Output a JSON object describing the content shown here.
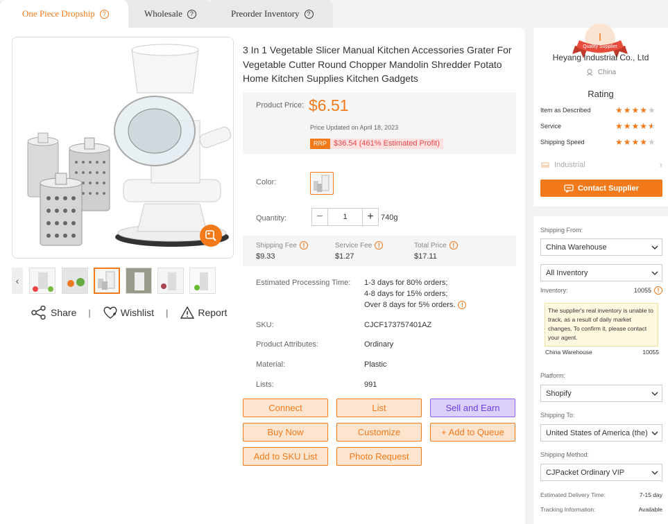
{
  "tabs": [
    {
      "label": "One Piece Dropship",
      "active": true
    },
    {
      "label": "Wholesale",
      "active": false
    },
    {
      "label": "Preorder Inventory",
      "active": false
    }
  ],
  "product": {
    "title": "3 In 1 Vegetable Slicer Manual Kitchen Accessories Grater For Vegetable Cutter Round Chopper Mandolin Shredder Potato Home Kitchen Supplies Kitchen Gadgets",
    "price_label": "Product Price:",
    "price": "$6.51",
    "price_updated": "Price Updated on April 18, 2023",
    "rrp_tag": "RRP",
    "rrp_value": "$36.54 (461% Estimated Profit)",
    "color_label": "Color:",
    "quantity_label": "Quantity:",
    "quantity": "1",
    "weight": "740g",
    "fees": [
      {
        "label": "Shipping Fee",
        "value": "$9.33"
      },
      {
        "label": "Service Fee",
        "value": "$1.27"
      },
      {
        "label": "Total Price",
        "value": "$17.11"
      }
    ],
    "processing_label": "Estimated Processing Time:",
    "processing": [
      "1-3 days for 80% orders;",
      "4-8 days for 15% orders;",
      "Over 8 days for 5% orders."
    ],
    "attributes": [
      {
        "label": "SKU:",
        "value": "CJCF173757401AZ"
      },
      {
        "label": "Product Attributes:",
        "value": "Ordinary"
      },
      {
        "label": "Material:",
        "value": "Plastic"
      },
      {
        "label": "Lists:",
        "value": "991"
      }
    ]
  },
  "share_row": {
    "share": "Share",
    "wishlist": "Wishlist",
    "report": "Report",
    "sep": "|"
  },
  "actions": {
    "connect": "Connect",
    "list": "List",
    "sell_earn": "Sell and Earn",
    "buy_now": "Buy Now",
    "customize": "Customize",
    "add_queue": "+ Add to Queue",
    "add_sku": "Add to SKU List",
    "photo_request": "Photo Request"
  },
  "supplier": {
    "badge_letter": "I",
    "badge_text": "Quality Supplier",
    "name": "Heyang Industrial Co., Ltd",
    "country": "China",
    "rating_heading": "Rating",
    "ratings": [
      {
        "label": "Item as Described",
        "stars": 4
      },
      {
        "label": "Service",
        "stars": 4.5
      },
      {
        "label": "Shipping Speed",
        "stars": 4
      }
    ],
    "industry": "Industrial",
    "contact": "Contact Supplier"
  },
  "options": {
    "shipping_from_label": "Shipping From:",
    "shipping_from": "China Warehouse",
    "inventory_filter": "All Inventory",
    "inventory_label": "Inventory:",
    "inventory_value": "10055",
    "note": "The supplier's real inventory is unable to track, as a result of daily market changes. To confirm it, please contact your agent.",
    "warehouse_name": "China Warehouse",
    "warehouse_value": "10055",
    "platform_label": "Platform:",
    "platform": "Shopify",
    "shipping_to_label": "Shipping To:",
    "shipping_to": "United States of America (the)",
    "method_label": "Shipping Method:",
    "method": "CJPacket Ordinary VIP",
    "delivery_label": "Estimated Delivery Time:",
    "delivery_value": "7-15 day",
    "tracking_label": "Tracking Information:",
    "tracking_value": "Available"
  },
  "colors": {
    "accent": "#f27a1a",
    "purple": "#8c5ef1"
  }
}
